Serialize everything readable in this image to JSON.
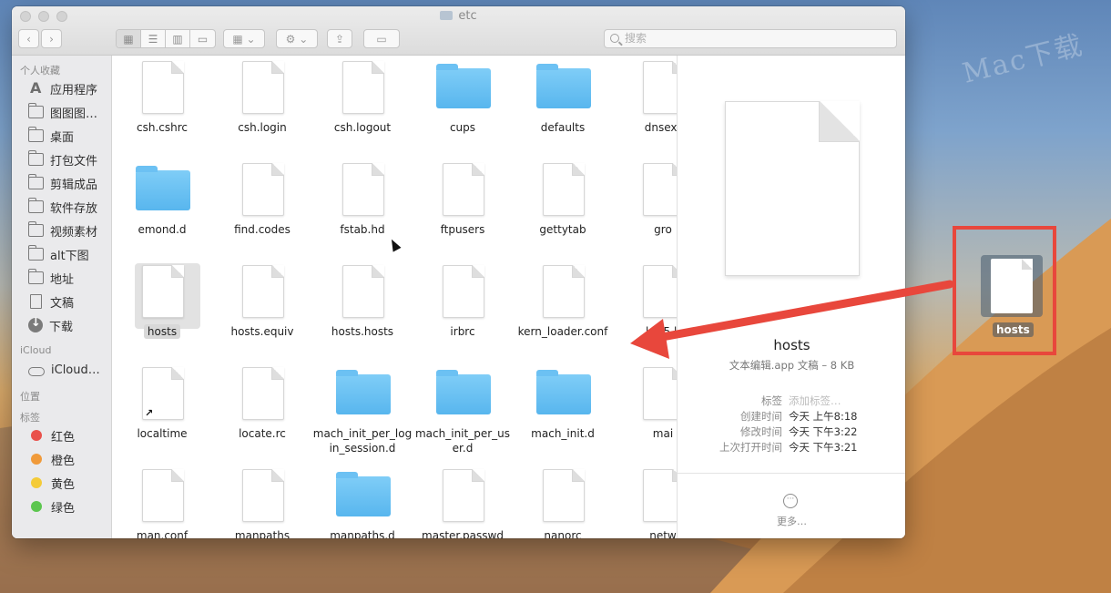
{
  "window": {
    "title": "etc",
    "search_placeholder": "搜索"
  },
  "sidebar": {
    "sections": [
      {
        "header": "个人收藏",
        "items": [
          {
            "label": "应用程序",
            "icon": "apps-icon"
          },
          {
            "label": "图图图…",
            "icon": "folder-icon"
          },
          {
            "label": "桌面",
            "icon": "desktop-icon"
          },
          {
            "label": "打包文件",
            "icon": "folder-icon"
          },
          {
            "label": "剪辑成品",
            "icon": "folder-icon"
          },
          {
            "label": "软件存放",
            "icon": "folder-icon"
          },
          {
            "label": "视频素材",
            "icon": "folder-icon"
          },
          {
            "label": "alt下图",
            "icon": "folder-icon"
          },
          {
            "label": "地址",
            "icon": "folder-icon"
          },
          {
            "label": "文稿",
            "icon": "document-icon"
          },
          {
            "label": "下载",
            "icon": "download-icon"
          }
        ]
      },
      {
        "header": "iCloud",
        "items": [
          {
            "label": "iCloud…",
            "icon": "cloud-icon"
          }
        ]
      },
      {
        "header": "位置",
        "items": []
      },
      {
        "header": "标签",
        "items": [
          {
            "label": "红色",
            "color": "#e9514b"
          },
          {
            "label": "橙色",
            "color": "#f09a3a"
          },
          {
            "label": "黄色",
            "color": "#f4cb38"
          },
          {
            "label": "绿色",
            "color": "#5cc64f"
          }
        ]
      }
    ]
  },
  "files": [
    {
      "name": "csh.cshrc",
      "type": "doc"
    },
    {
      "name": "csh.login",
      "type": "doc"
    },
    {
      "name": "csh.logout",
      "type": "doc"
    },
    {
      "name": "cups",
      "type": "folder"
    },
    {
      "name": "defaults",
      "type": "folder"
    },
    {
      "name": "dnsext",
      "type": "doc"
    },
    {
      "name": "emond.d",
      "type": "folder"
    },
    {
      "name": "find.codes",
      "type": "doc"
    },
    {
      "name": "fstab.hd",
      "type": "doc"
    },
    {
      "name": "ftpusers",
      "type": "doc"
    },
    {
      "name": "gettytab",
      "type": "doc"
    },
    {
      "name": "gro",
      "type": "doc"
    },
    {
      "name": "hosts",
      "type": "doc",
      "selected": true
    },
    {
      "name": "hosts.equiv",
      "type": "doc"
    },
    {
      "name": "hosts.hosts",
      "type": "doc"
    },
    {
      "name": "irbrc",
      "type": "doc"
    },
    {
      "name": "kern_loader.conf",
      "type": "doc"
    },
    {
      "name": "krb5.k",
      "type": "doc"
    },
    {
      "name": "localtime",
      "type": "doc",
      "alias": true
    },
    {
      "name": "locate.rc",
      "type": "doc"
    },
    {
      "name": "mach_init_per_login_session.d",
      "type": "folder"
    },
    {
      "name": "mach_init_per_user.d",
      "type": "folder"
    },
    {
      "name": "mach_init.d",
      "type": "folder"
    },
    {
      "name": "mai",
      "type": "doc"
    },
    {
      "name": "man.conf",
      "type": "doc"
    },
    {
      "name": "manpaths",
      "type": "doc"
    },
    {
      "name": "manpaths.d",
      "type": "folder"
    },
    {
      "name": "master.passwd",
      "type": "doc"
    },
    {
      "name": "nanorc",
      "type": "doc"
    },
    {
      "name": "netw",
      "type": "doc"
    }
  ],
  "file_label_lines": {
    "mach_init_per_login_session.d": [
      "mach_init_per_log",
      "in_session.d"
    ],
    "mach_init_per_user.d": [
      "mach_init_per_us",
      "er.d"
    ]
  },
  "preview": {
    "name": "hosts",
    "kind": "文本编辑.app 文稿 – 8 KB",
    "rows": [
      {
        "key": "标签",
        "value": "添加标签…",
        "placeholder": true
      },
      {
        "key": "创建时间",
        "value": "今天 上午8:18"
      },
      {
        "key": "修改时间",
        "value": "今天 下午3:22"
      },
      {
        "key": "上次打开时间",
        "value": "今天 下午3:21"
      }
    ],
    "more_label": "更多…"
  },
  "desktop": {
    "file_label": "hosts",
    "watermark": "Mac下载",
    "highlight_color": "#e8473c"
  }
}
